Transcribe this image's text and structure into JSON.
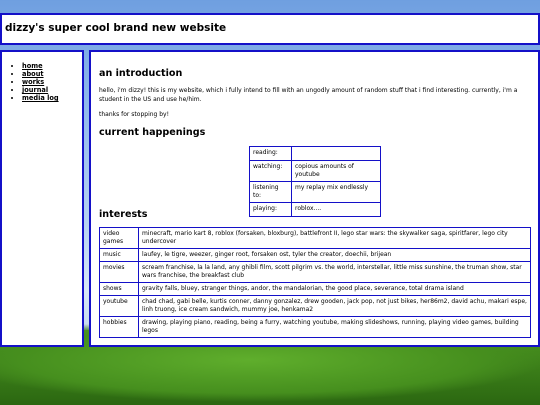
{
  "header": {
    "title": "dizzy's super cool brand new website"
  },
  "nav": {
    "items": [
      {
        "label": "home"
      },
      {
        "label": "about"
      },
      {
        "label": "works"
      },
      {
        "label": "journal"
      },
      {
        "label": "media log"
      }
    ]
  },
  "intro": {
    "heading": "an introduction",
    "paragraph1": "hello, i'm dizzy! this is my website, which i fully intend to fill with an ungodly amount of random stuff that i find interesting. currently, i'm a student in the US and use he/him.",
    "paragraph2": "thanks for stopping by!"
  },
  "current": {
    "heading": "current happenings",
    "rows": [
      {
        "key": "reading:",
        "value": ""
      },
      {
        "key": "watching:",
        "value": "copious amounts of youtube"
      },
      {
        "key": "listening to:",
        "value": "my replay mix endlessly"
      },
      {
        "key": "playing:",
        "value": "roblox...."
      }
    ]
  },
  "interests": {
    "heading": "interests",
    "rows": [
      {
        "category": "video games",
        "items": "minecraft, mario kart 8, roblox (forsaken, bloxburg), battlefront II, lego star wars: the skywalker saga, spiritfarer, lego city undercover"
      },
      {
        "category": "music",
        "items": "laufey, le tigre, weezer, ginger root, forsaken ost, tyler the creator, doechii, brijean"
      },
      {
        "category": "movies",
        "items": "scream franchise, la la land, any ghibli film, scott pilgrim vs. the world, interstellar, little miss sunshine, the truman show, star wars franchise, the breakfast club"
      },
      {
        "category": "shows",
        "items": "gravity falls, bluey, stranger things, andor, the mandalorian, the good place, severance, total drama island"
      },
      {
        "category": "youtube",
        "items": "chad chad, gabi belle, kurtis conner, danny gonzalez, drew gooden, jack pop, not just bikes, her86m2, david achu, makari espe, linh truong, ice cream sandwich, mummy joe, henkama2"
      },
      {
        "category": "hobbies",
        "items": "drawing, playing piano, reading, being a furry, watching youtube, making slideshows, running, playing video games, building legos"
      }
    ]
  }
}
